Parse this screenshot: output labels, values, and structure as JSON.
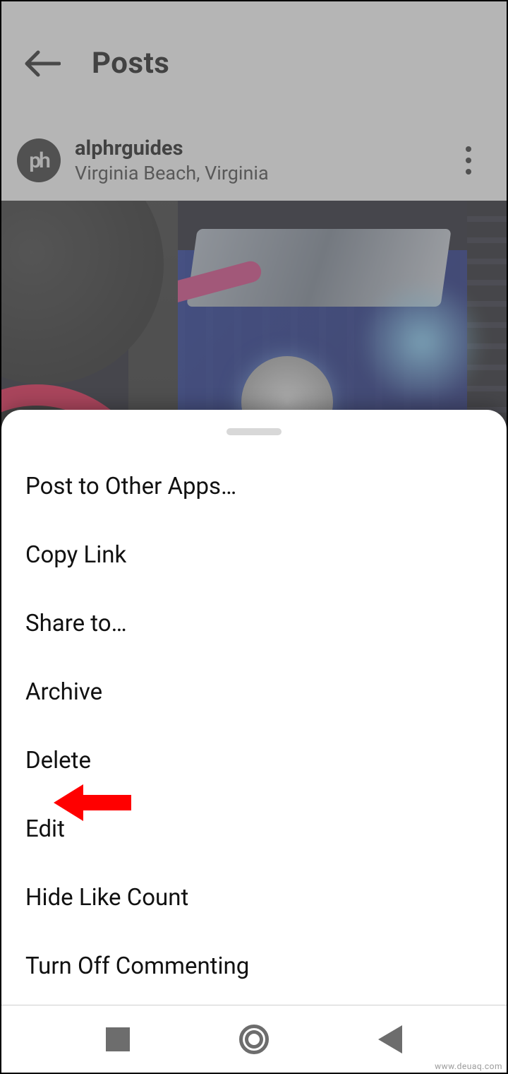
{
  "header": {
    "title": "Posts"
  },
  "post": {
    "username": "alphrguides",
    "location": "Virginia Beach, Virginia",
    "avatar_text": "ph"
  },
  "sheet": {
    "options": [
      "Post to Other Apps…",
      "Copy Link",
      "Share to…",
      "Archive",
      "Delete",
      "Edit",
      "Hide Like Count",
      "Turn Off Commenting"
    ]
  },
  "annotation": {
    "target_option_index": 5
  },
  "watermark": "www.deuaq.com"
}
